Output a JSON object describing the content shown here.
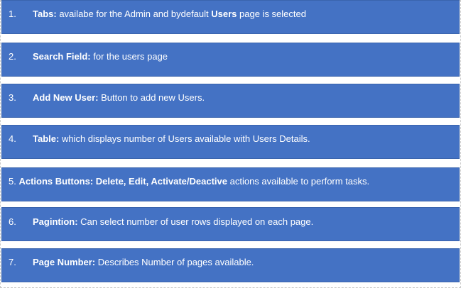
{
  "items": [
    {
      "number": "1.",
      "label": "Tabs:",
      "text_a": " availabe for the Admin and bydefault ",
      "bold_b": "Users",
      "text_c": " page is selected"
    },
    {
      "number": "2.",
      "label": "Search Field:",
      "text": " for the users page"
    },
    {
      "number": "3.",
      "label": "Add New User:",
      "text": " Button to add new Users."
    },
    {
      "number": "4.",
      "label": "Table:",
      "text": " which displays number of Users available with Users Details."
    },
    {
      "number": "5.",
      "label": "Actions Buttons: Delete, Edit, Activate/Deactive",
      "text": " actions available to perform tasks."
    },
    {
      "number": "6.",
      "label": "Pagintion:",
      "text": " Can select number of user rows displayed on each page."
    },
    {
      "number": "7.",
      "label": "Page Number:",
      "text": " Describes Number of pages available."
    }
  ],
  "colors": {
    "row_fill": "#4472c4",
    "text": "#ffffff"
  }
}
